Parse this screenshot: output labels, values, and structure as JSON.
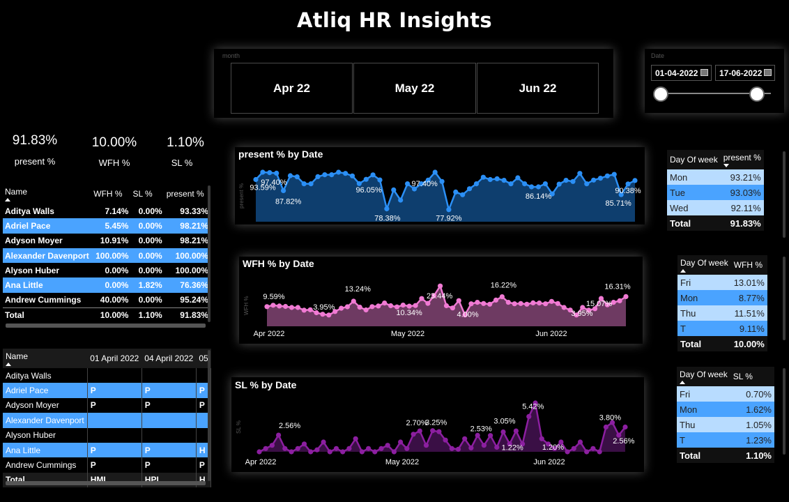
{
  "header": {
    "title": "Atliq HR Insights"
  },
  "month_slicer": {
    "label": "month",
    "options": [
      "Apr 22",
      "May 22",
      "Jun 22"
    ]
  },
  "date_slicer": {
    "label": "Date",
    "start": "01-04-2022",
    "end": "17-06-2022"
  },
  "kpis": [
    {
      "value": "91.83%",
      "label": "present %"
    },
    {
      "value": "10.00%",
      "label": "WFH %"
    },
    {
      "value": "1.10%",
      "label": "SL %"
    }
  ],
  "employee_table": {
    "columns": [
      "Name",
      "WFH %",
      "SL %",
      "present %"
    ],
    "rows": [
      [
        "Aditya Walls",
        "7.14%",
        "0.00%",
        "93.33%"
      ],
      [
        "Adriel Pace",
        "5.45%",
        "0.00%",
        "98.21%"
      ],
      [
        "Adyson Moyer",
        "10.91%",
        "0.00%",
        "98.21%"
      ],
      [
        "Alexander Davenport",
        "100.00%",
        "0.00%",
        "100.00%"
      ],
      [
        "Alyson Huber",
        "0.00%",
        "0.00%",
        "100.00%"
      ],
      [
        "Ana Little",
        "0.00%",
        "1.82%",
        "76.36%"
      ],
      [
        "Andrew Cummings",
        "40.00%",
        "0.00%",
        "95.24%"
      ]
    ],
    "total": [
      "Total",
      "10.00%",
      "1.10%",
      "91.83%"
    ]
  },
  "attendance_table": {
    "columns": [
      "Name",
      "01 April 2022",
      "04 April 2022",
      "05"
    ],
    "rows": [
      [
        "Aditya Walls",
        "",
        "",
        ""
      ],
      [
        "Adriel Pace",
        "P",
        "P",
        "P"
      ],
      [
        "Adyson Moyer",
        "P",
        "P",
        "P"
      ],
      [
        "Alexander Davenport",
        "",
        "",
        ""
      ],
      [
        "Alyson Huber",
        "",
        "",
        ""
      ],
      [
        "Ana Little",
        "P",
        "P",
        "H"
      ],
      [
        "Andrew Cummings",
        "P",
        "P",
        "P"
      ]
    ],
    "total": [
      "Total",
      "HML",
      "HPL",
      "H"
    ]
  },
  "present_chart": {
    "title": "present % by Date",
    "ylabel": "present %"
  },
  "wfh_chart": {
    "title": "WFH % by Date",
    "ylabel": "WFH %"
  },
  "sl_chart": {
    "title": "SL % by Date",
    "ylabel": "SL %"
  },
  "present_dow": {
    "columns": [
      "Day Of week",
      "present %"
    ],
    "rows": [
      [
        "Mon",
        "93.21%"
      ],
      [
        "Tue",
        "93.03%"
      ],
      [
        "Wed",
        "92.11%"
      ]
    ],
    "total": [
      "Total",
      "91.83%"
    ]
  },
  "wfh_dow": {
    "columns": [
      "Day Of week",
      "WFH %"
    ],
    "rows": [
      [
        "Fri",
        "13.01%"
      ],
      [
        "Mon",
        "8.77%"
      ],
      [
        "Thu",
        "11.51%"
      ],
      [
        "T",
        "9.11%"
      ]
    ],
    "total": [
      "Total",
      "10.00%"
    ]
  },
  "sl_dow": {
    "columns": [
      "Day Of week",
      "SL %"
    ],
    "rows": [
      [
        "Fri",
        "0.70%"
      ],
      [
        "Mon",
        "1.62%"
      ],
      [
        "Thu",
        "1.05%"
      ],
      [
        "T",
        "1.23%"
      ]
    ],
    "total": [
      "Total",
      "1.10%"
    ]
  },
  "colors": {
    "present": "#2b8ff5",
    "present_fill": "#0e3e6e",
    "wfh": "#f07ad3",
    "wfh_fill": "#6e3a62",
    "sl": "#8c1fa0",
    "sl_fill": "#3a0f45",
    "blue_row": "#4aa3ff",
    "light_row": "#b8dcff"
  },
  "chart_data": [
    {
      "type": "area",
      "title": "present % by Date",
      "ylabel": "present %",
      "x": [
        "2022-04-01",
        "2022-04-04",
        "2022-04-05",
        "2022-04-06",
        "2022-04-07",
        "2022-04-08",
        "2022-04-11",
        "2022-04-12",
        "2022-04-13",
        "2022-04-14",
        "2022-04-15",
        "2022-04-18",
        "2022-04-19",
        "2022-04-20",
        "2022-04-21",
        "2022-04-22",
        "2022-04-25",
        "2022-04-26",
        "2022-04-27",
        "2022-04-28",
        "2022-04-29",
        "2022-05-02",
        "2022-05-03",
        "2022-05-04",
        "2022-05-05",
        "2022-05-06",
        "2022-05-09",
        "2022-05-10",
        "2022-05-11",
        "2022-05-12",
        "2022-05-13",
        "2022-05-16",
        "2022-05-17",
        "2022-05-18",
        "2022-05-19",
        "2022-05-20",
        "2022-05-23",
        "2022-05-24",
        "2022-05-25",
        "2022-05-26",
        "2022-05-27",
        "2022-05-30",
        "2022-05-31",
        "2022-06-01",
        "2022-06-02",
        "2022-06-03",
        "2022-06-06",
        "2022-06-07",
        "2022-06-08",
        "2022-06-09",
        "2022-06-10",
        "2022-06-13",
        "2022-06-14",
        "2022-06-15",
        "2022-06-16",
        "2022-06-17"
      ],
      "values": [
        93.59,
        97.4,
        97.2,
        96.9,
        87.82,
        95.6,
        95.0,
        91.4,
        91.4,
        95.1,
        96.1,
        96.1,
        97.4,
        96.8,
        95.5,
        91.5,
        93.7,
        96.05,
        93.4,
        78.38,
        88.2,
        82.9,
        91.4,
        88.7,
        91.4,
        93.3,
        97.4,
        92.6,
        77.92,
        87.1,
        85.7,
        88.8,
        91.4,
        94.8,
        93.6,
        94.0,
        93.2,
        91.4,
        94.5,
        91.4,
        89.8,
        89.8,
        91.4,
        86.14,
        91.2,
        93.2,
        92.6,
        96.8,
        91.4,
        93.3,
        94.3,
        95.5,
        96.3,
        85.71,
        91.3,
        93.1
      ],
      "annotations": [
        "93.59%",
        "97.40%",
        "87.82%",
        "96.05%",
        "78.38%",
        "97.40%",
        "77.92%",
        "86.14%",
        "85.71%",
        "90.38%"
      ]
    },
    {
      "type": "area",
      "title": "WFH % by Date",
      "ylabel": "WFH %",
      "x_ticks": [
        "Apr 2022",
        "May 2022",
        "Jun 2022"
      ],
      "values": [
        9.59,
        10.5,
        10.0,
        9.7,
        9.0,
        9.0,
        7.2,
        7.5,
        5.5,
        4.5,
        3.95,
        6.3,
        8.5,
        9.5,
        13.24,
        9.2,
        7.4,
        9.6,
        10.0,
        12.0,
        10.2,
        9.4,
        10.6,
        9.9,
        10.34,
        15.0,
        11.8,
        17.0,
        23.44,
        10.2,
        8.7,
        13.6,
        4.0,
        11.5,
        12.5,
        11.7,
        11.2,
        14.0,
        16.22,
        12.5,
        11.5,
        11.7,
        11.2,
        12.1,
        12.0,
        11.5,
        13.1,
        11.7,
        9.0,
        7.3,
        3.95,
        9.0,
        7.2,
        8.2,
        15.07,
        10.8,
        12.5,
        13.5,
        16.31
      ],
      "annotations": [
        "9.59%",
        "3.95%",
        "13.24%",
        "10.34%",
        "23.44%",
        "4.00%",
        "16.22%",
        "3.95%",
        "15.07%",
        "16.31%"
      ]
    },
    {
      "type": "area",
      "title": "SL % by Date",
      "ylabel": "SL %",
      "x_ticks": [
        "Apr 2022",
        "May 2022",
        "Jun 2022"
      ],
      "values": [
        0.0,
        0.5,
        1.0,
        2.56,
        0.5,
        0.0,
        0.5,
        1.2,
        0.0,
        0.3,
        1.5,
        0.0,
        0.5,
        0.0,
        0.5,
        2.0,
        0.0,
        0.5,
        0.0,
        0.5,
        1.0,
        0.0,
        1.5,
        0.5,
        2.7,
        3.2,
        1.0,
        3.25,
        3.1,
        1.8,
        0.5,
        0.4,
        2.0,
        0.6,
        2.53,
        1.0,
        2.5,
        0.7,
        3.05,
        1.22,
        3.2,
        1.2,
        5.42,
        7.5,
        2.0,
        1.2,
        0.5,
        1.5,
        0.0,
        0.5,
        1.5,
        0.0,
        0.5,
        0.0,
        3.8,
        4.5,
        2.56,
        3.8
      ],
      "annotations": [
        "2.56%",
        "2.70%",
        "3.25%",
        "2.53%",
        "3.05%",
        "1.22%",
        "5.42%",
        "1.20%",
        "3.80%",
        "2.56%"
      ]
    }
  ]
}
